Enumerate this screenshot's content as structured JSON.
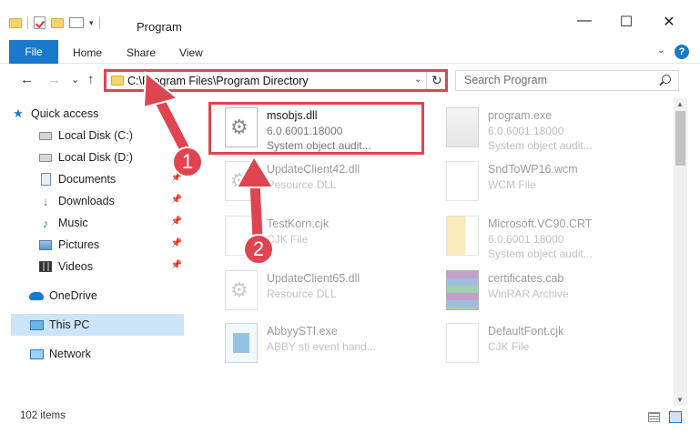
{
  "window": {
    "title": "Program",
    "controls": {
      "minimize": "—",
      "maximize": "☐",
      "close": "✕"
    }
  },
  "ribbon": {
    "tabs": [
      "File",
      "Home",
      "Share",
      "View"
    ],
    "help": "?"
  },
  "navbar": {
    "back": "←",
    "forward": "→",
    "recent": "⌄",
    "up": "↑",
    "address": "C:\\Program Files\\Program Directory",
    "dropdown": "⌄",
    "refresh": "↻",
    "search_placeholder": "Search Program"
  },
  "sidebar": {
    "items": [
      {
        "label": "Quick access",
        "icon": "star-icon"
      },
      {
        "label": "Local Disk (C:)",
        "icon": "disk-icon"
      },
      {
        "label": "Local Disk (D:)",
        "icon": "disk-icon"
      },
      {
        "label": "Documents",
        "icon": "document-icon",
        "pinned": true
      },
      {
        "label": "Downloads",
        "icon": "download-icon",
        "pinned": true
      },
      {
        "label": "Music",
        "icon": "music-icon",
        "pinned": true
      },
      {
        "label": "Pictures",
        "icon": "pictures-icon",
        "pinned": true
      },
      {
        "label": "Videos",
        "icon": "videos-icon",
        "pinned": true
      },
      {
        "label": "OneDrive",
        "icon": "cloud-icon"
      },
      {
        "label": "This PC",
        "icon": "computer-icon",
        "selected": true
      },
      {
        "label": "Network",
        "icon": "network-icon"
      }
    ],
    "pin_glyph": "📌"
  },
  "files": [
    {
      "name": "msobjs.dll",
      "line1": "6.0.6001.18000",
      "line2": "System object audit...",
      "icon": "dll-icon",
      "highlighted": true
    },
    {
      "name": "program.exe",
      "line1": "6.0.6001.18000",
      "line2": "System object audit...",
      "icon": "program-icon"
    },
    {
      "name": "UpdateClient42.dll",
      "line1": "Resource DLL",
      "line2": "",
      "icon": "dll-icon"
    },
    {
      "name": "SndToWP16.wcm",
      "line1": "WCM File",
      "line2": "",
      "icon": "file-icon"
    },
    {
      "name": "TestKorn.cjk",
      "line1": "CJK File",
      "line2": "",
      "icon": "file-icon"
    },
    {
      "name": "Microsoft.VC90.CRT",
      "line1": "6.0.6001.18000",
      "line2": "System object audit...",
      "icon": "folder-file-icon"
    },
    {
      "name": "UpdateClient65.dll",
      "line1": "Resource DLL",
      "line2": "",
      "icon": "dll-icon"
    },
    {
      "name": "certificates.cab",
      "line1": "WinRAR Archive",
      "line2": "",
      "icon": "winrar-icon"
    },
    {
      "name": "AbbyySTI.exe",
      "line1": "ABBY sti event hand...",
      "line2": "",
      "icon": "exe-icon"
    },
    {
      "name": "DefaultFont.cjk",
      "line1": "CJK File",
      "line2": "",
      "icon": "file-icon"
    }
  ],
  "status": {
    "count": "102 items"
  },
  "annotations": {
    "badge1": "1",
    "badge2": "2",
    "color": "#e04450"
  },
  "colors": {
    "accent": "#1979ca",
    "selection": "#cce4f7",
    "highlight": "#e04450"
  }
}
